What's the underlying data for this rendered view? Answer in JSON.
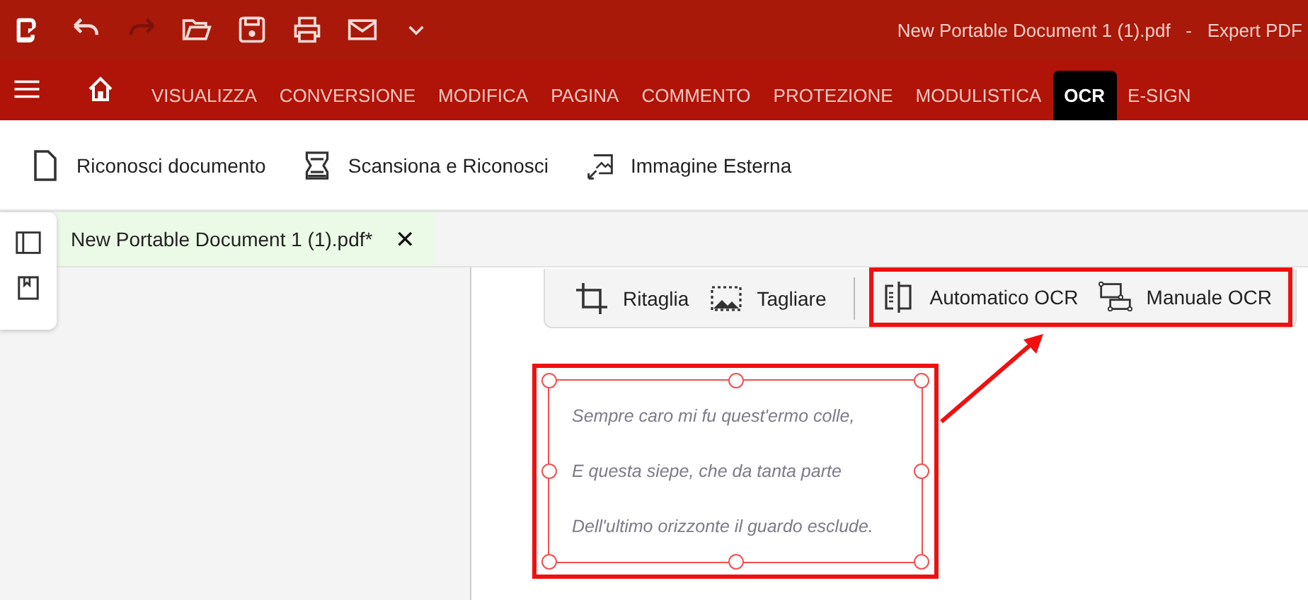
{
  "window": {
    "title": "New Portable Document 1 (1).pdf   -   Expert PDF"
  },
  "quick_access": [
    {
      "kind": "undo",
      "disabled": false
    },
    {
      "kind": "redo",
      "disabled": true
    },
    {
      "kind": "open"
    },
    {
      "kind": "save"
    },
    {
      "kind": "print"
    },
    {
      "kind": "mail"
    },
    {
      "kind": "more"
    }
  ],
  "menu_tabs": [
    {
      "label": "VISUALIZZA",
      "selected": false
    },
    {
      "label": "CONVERSIONE",
      "selected": false
    },
    {
      "label": "MODIFICA",
      "selected": false
    },
    {
      "label": "PAGINA",
      "selected": false
    },
    {
      "label": "COMMENTO",
      "selected": false
    },
    {
      "label": "PROTEZIONE",
      "selected": false
    },
    {
      "label": "MODULISTICA",
      "selected": false
    },
    {
      "label": "OCR",
      "selected": true
    },
    {
      "label": "E-SIGN",
      "selected": false
    }
  ],
  "ribbon": [
    {
      "kind": "document",
      "label": "Riconosci documento"
    },
    {
      "kind": "scanner",
      "label": "Scansiona e Riconosci"
    },
    {
      "kind": "image",
      "label": "Immagine Esterna"
    }
  ],
  "document_tab": {
    "label": "New Portable Document 1 (1).pdf*",
    "close": "✕"
  },
  "floating_toolbar": [
    {
      "kind": "crop",
      "label": "Ritaglia",
      "highlighted": false
    },
    {
      "kind": "cut",
      "label": "Tagliare",
      "highlighted": false
    },
    {
      "kind": "auto",
      "label": "Automatico OCR",
      "highlighted": true
    },
    {
      "kind": "manual",
      "label": "Manuale OCR",
      "highlighted": true
    }
  ],
  "text_frame": {
    "lines": [
      "Sempre caro mi fu quest'ermo colle,",
      "E questa siepe, che da tanta parte",
      "Dell'ultimo orizzonte il guardo esclude."
    ],
    "highlighted": true
  }
}
